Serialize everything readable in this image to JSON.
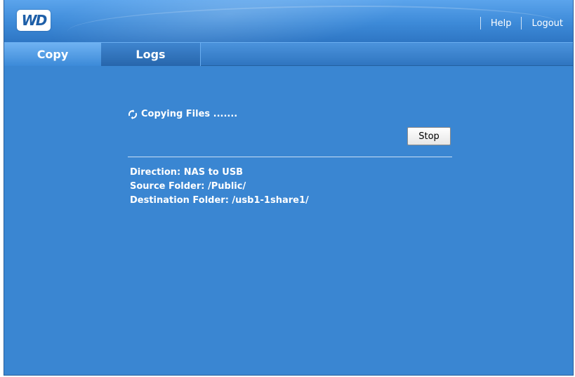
{
  "header": {
    "logo_text": "WD",
    "links": {
      "help": "Help",
      "logout": "Logout"
    }
  },
  "tabs": [
    {
      "label": "Copy",
      "active": true
    },
    {
      "label": "Logs",
      "active": false
    }
  ],
  "status": {
    "text": "Copying Files .......",
    "icon": "refresh-icon"
  },
  "buttons": {
    "stop_label": "Stop"
  },
  "details": {
    "direction": "Direction: NAS to USB",
    "source": "Source Folder: /Public/",
    "destination": "Destination Folder: /usb1-1share1/"
  },
  "colors": {
    "background": "#3a86d2",
    "text": "#ffffff"
  }
}
